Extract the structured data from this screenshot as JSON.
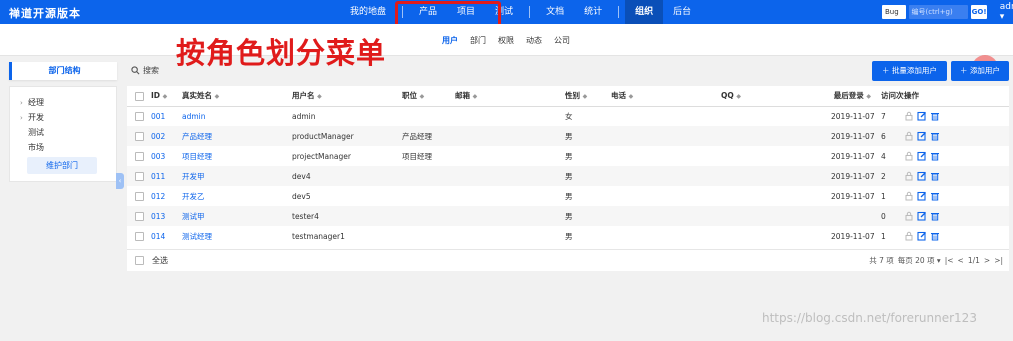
{
  "brand": "禅道开源版本",
  "nav": [
    "我的地盘",
    "产品",
    "项目",
    "测试",
    "文档",
    "统计",
    "组织",
    "后台"
  ],
  "bug_select": "Bug ▾",
  "search_placeholder": "编号(ctrl+g)",
  "go_label": "GO!",
  "user": "admin ▾",
  "subtabs": [
    "用户",
    "部门",
    "权限",
    "动态",
    "公司"
  ],
  "annotation": "按角色划分菜单",
  "sidebar": {
    "title": "部门结构",
    "tree": [
      {
        "label": "经理",
        "expandable": true
      },
      {
        "label": "开发",
        "expandable": true
      },
      {
        "label": "测试",
        "expandable": false
      },
      {
        "label": "市场",
        "expandable": false
      }
    ],
    "maintain_button": "维护部门"
  },
  "toolbar": {
    "search": "搜索",
    "batch_add": "批量添加用户",
    "add_user": "添加用户"
  },
  "table": {
    "headers": [
      "ID",
      "真实姓名",
      "用户名",
      "职位",
      "邮箱",
      "性别",
      "电话",
      "QQ",
      "最后登录",
      "访问次数",
      "操作"
    ],
    "rows": [
      {
        "id": "001",
        "name": "admin",
        "username": "admin",
        "role": "",
        "email": "",
        "gender": "女",
        "phone": "",
        "qq": "",
        "last": "2019-11-07",
        "visits": "7"
      },
      {
        "id": "002",
        "name": "产品经理",
        "username": "productManager",
        "role": "产品经理",
        "email": "",
        "gender": "男",
        "phone": "",
        "qq": "",
        "last": "2019-11-07",
        "visits": "6"
      },
      {
        "id": "003",
        "name": "项目经理",
        "username": "projectManager",
        "role": "项目经理",
        "email": "",
        "gender": "男",
        "phone": "",
        "qq": "",
        "last": "2019-11-07",
        "visits": "4"
      },
      {
        "id": "011",
        "name": "开发甲",
        "username": "dev4",
        "role": "",
        "email": "",
        "gender": "男",
        "phone": "",
        "qq": "",
        "last": "2019-11-07",
        "visits": "2"
      },
      {
        "id": "012",
        "name": "开发乙",
        "username": "dev5",
        "role": "",
        "email": "",
        "gender": "男",
        "phone": "",
        "qq": "",
        "last": "2019-11-07",
        "visits": "1"
      },
      {
        "id": "013",
        "name": "测试甲",
        "username": "tester4",
        "role": "",
        "email": "",
        "gender": "男",
        "phone": "",
        "qq": "",
        "last": "",
        "visits": "0"
      },
      {
        "id": "014",
        "name": "测试经理",
        "username": "testmanager1",
        "role": "",
        "email": "",
        "gender": "男",
        "phone": "",
        "qq": "",
        "last": "2019-11-07",
        "visits": "1"
      }
    ],
    "select_all": "全选"
  },
  "pager": {
    "summary": "共 7 项",
    "per_page": "每页 20 项 ▾",
    "first": "|<",
    "prev": "<",
    "page": "1/1",
    "next": ">",
    "last": ">|"
  },
  "watermark": "https://blog.csdn.net/forerunner123",
  "colors": {
    "primary": "#0c64eb",
    "annotation": "#e01b1b"
  }
}
